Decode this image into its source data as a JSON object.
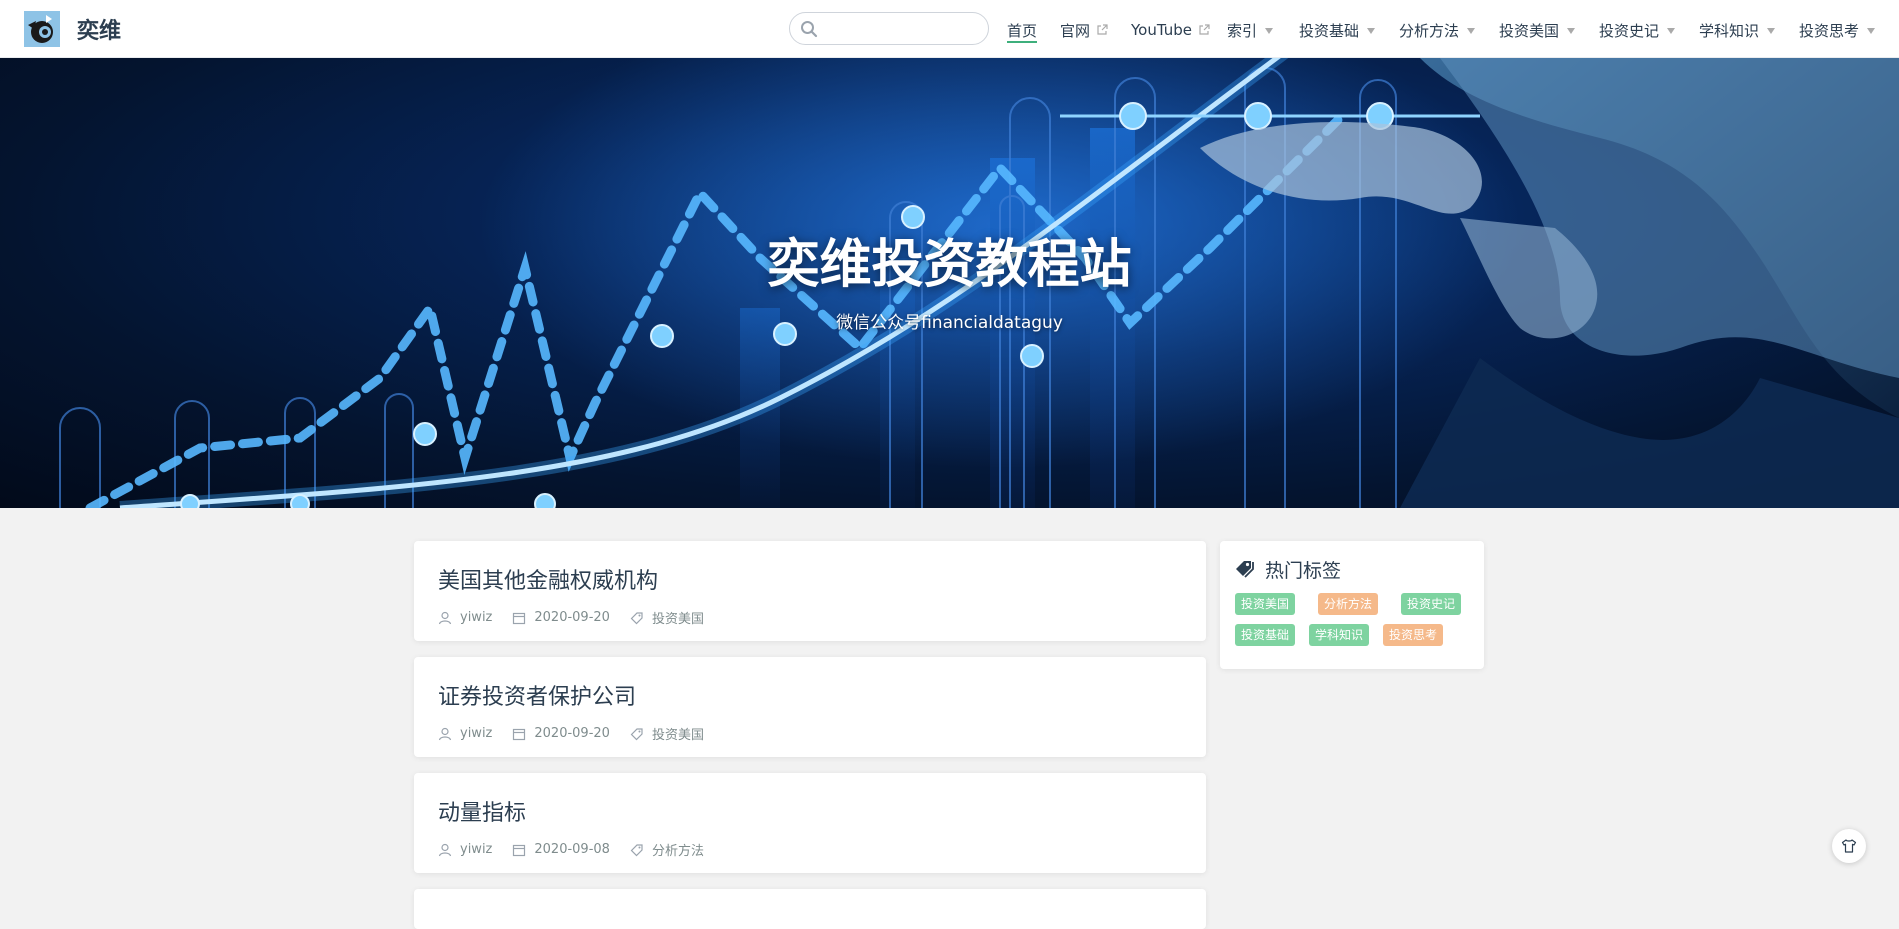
{
  "nav": {
    "site_name": "奕维",
    "search_placeholder": "",
    "items": [
      {
        "label": "首页",
        "icon": ""
      },
      {
        "label": "官网",
        "icon": "external-link-icon"
      },
      {
        "label": "YouTube",
        "icon": "external-link-icon"
      },
      {
        "label": "索引",
        "icon": "caret-down-icon"
      },
      {
        "label": "投资基础",
        "icon": "caret-down-icon"
      },
      {
        "label": "分析方法",
        "icon": "caret-down-icon"
      },
      {
        "label": "投资美国",
        "icon": "caret-down-icon"
      },
      {
        "label": "投资史记",
        "icon": "caret-down-icon"
      },
      {
        "label": "学科知识",
        "icon": "caret-down-icon"
      },
      {
        "label": "投资思考",
        "icon": "caret-down-icon"
      }
    ],
    "active_color": "#3eaf7c"
  },
  "hero": {
    "title": "奕维投资教程站",
    "subtitle": "微信公众号financialdataguy"
  },
  "posts": [
    {
      "title": "美国其他金融权威机构",
      "author": "yiwiz",
      "date": "2020-09-20",
      "tag": "投资美国"
    },
    {
      "title": "证券投资者保护公司",
      "author": "yiwiz",
      "date": "2020-09-20",
      "tag": "投资美国"
    },
    {
      "title": "动量指标",
      "author": "yiwiz",
      "date": "2020-09-08",
      "tag": "分析方法"
    }
  ],
  "sidebar": {
    "title": "热门标签",
    "tags": [
      {
        "label": "投资美国",
        "color": "#7ed3a0"
      },
      {
        "label": "分析方法",
        "color": "#f5b98a"
      },
      {
        "label": "投资史记",
        "color": "#7ed3a0"
      },
      {
        "label": "投资基础",
        "color": "#7ed3a0"
      },
      {
        "label": "学科知识",
        "color": "#7ed3a0"
      },
      {
        "label": "投资思考",
        "color": "#f5b98a"
      }
    ]
  },
  "icons": {
    "theme": "shirt-icon",
    "search": "search-icon",
    "author": "user-icon",
    "date": "calendar-icon",
    "tag": "tag-icon"
  }
}
